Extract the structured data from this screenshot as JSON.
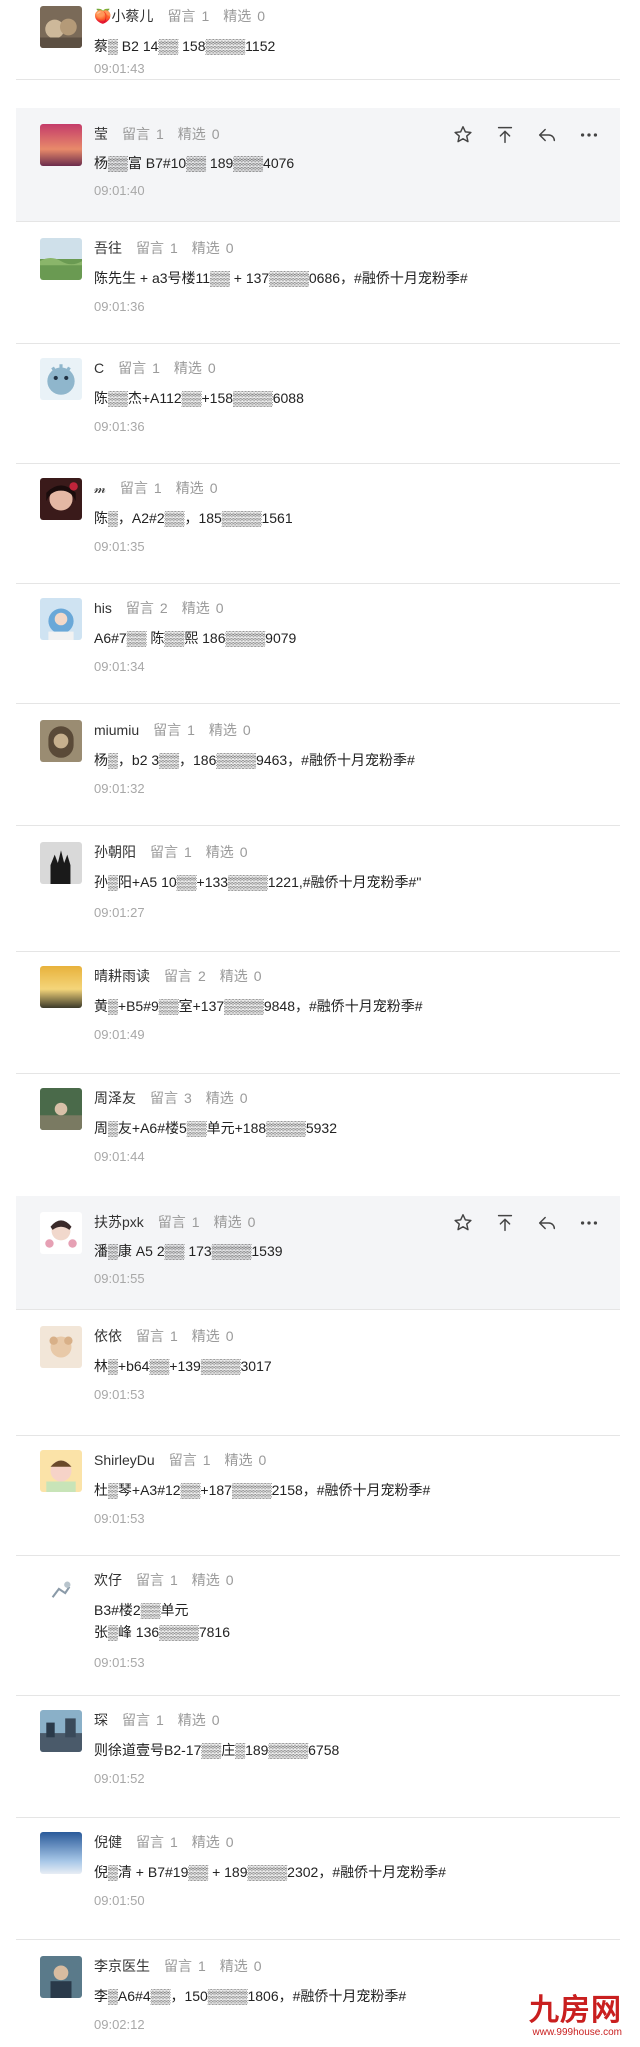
{
  "labels": {
    "comment": "留言",
    "featured": "精选"
  },
  "comments": [
    {
      "nickname": "小蔡儿",
      "prefix_icon": "peach-emoji",
      "comments": "1",
      "featured": "0",
      "lines": [
        "蔡▒   B2 14▒▒    158▒▒▒▒1152"
      ],
      "time": "09:01:43"
    },
    {
      "nickname": "莹",
      "comments": "1",
      "featured": "0",
      "lines": [
        "杨▒▒富 B7#10▒▒ 189▒▒▒4076"
      ],
      "time": "09:01:40",
      "highlighted": true
    },
    {
      "nickname": "吾往",
      "comments": "1",
      "featured": "0",
      "lines": [
        "陈先生 + a3号楼11▒▒ + 137▒▒▒▒0686，#融侨十月宠粉季#"
      ],
      "time": "09:01:36"
    },
    {
      "nickname": "C",
      "comments": "1",
      "featured": "0",
      "lines": [
        "陈▒▒杰+A112▒▒+158▒▒▒▒6088"
      ],
      "time": "09:01:36"
    },
    {
      "nickname": "𝓂",
      "comments": "1",
      "featured": "0",
      "lines": [
        "陈▒，A2#2▒▒，185▒▒▒▒1561"
      ],
      "time": "09:01:35"
    },
    {
      "nickname": "his",
      "comments": "2",
      "featured": "0",
      "lines": [
        "A6#7▒▒   陈▒▒熙 186▒▒▒▒9079"
      ],
      "time": "09:01:34"
    },
    {
      "nickname": "miumiu",
      "comments": "1",
      "featured": "0",
      "lines": [
        "杨▒，b2 3▒▒，186▒▒▒▒9463，#融侨十月宠粉季#"
      ],
      "time": "09:01:32"
    },
    {
      "nickname": "孙朝阳",
      "comments": "1",
      "featured": "0",
      "lines": [
        "孙▒阳+A5 10▒▒+133▒▒▒▒1221,#融侨十月宠粉季#\""
      ],
      "time": "09:01:27"
    },
    {
      "nickname": "晴耕雨读",
      "comments": "2",
      "featured": "0",
      "lines": [
        "黄▒+B5#9▒▒室+137▒▒▒▒9848，#融侨十月宠粉季#"
      ],
      "time": "09:01:49"
    },
    {
      "nickname": "周泽友",
      "comments": "3",
      "featured": "0",
      "lines": [
        "周▒友+A6#楼5▒▒单元+188▒▒▒▒5932"
      ],
      "time": "09:01:44"
    },
    {
      "nickname": "扶苏pxk",
      "comments": "1",
      "featured": "0",
      "lines": [
        "潘▒康 A5 2▒▒ 173▒▒▒▒1539"
      ],
      "time": "09:01:55",
      "highlighted": true
    },
    {
      "nickname": "依依",
      "comments": "1",
      "featured": "0",
      "lines": [
        "林▒+b64▒▒+139▒▒▒▒3017"
      ],
      "time": "09:01:53"
    },
    {
      "nickname": "ShirleyDu",
      "comments": "1",
      "featured": "0",
      "lines": [
        "杜▒琴+A3#12▒▒+187▒▒▒▒2158，#融侨十月宠粉季#"
      ],
      "time": "09:01:53"
    },
    {
      "nickname": "欢仔",
      "comments": "1",
      "featured": "0",
      "lines": [
        "B3#楼2▒▒单元",
        "张▒峰 136▒▒▒▒7816"
      ],
      "time": "09:01:53"
    },
    {
      "nickname": "琛",
      "comments": "1",
      "featured": "0",
      "lines": [
        "则徐道壹号B2-17▒▒庄▒189▒▒▒▒6758"
      ],
      "time": "09:01:52"
    },
    {
      "nickname": "倪健",
      "comments": "1",
      "featured": "0",
      "lines": [
        "倪▒清 + B7#19▒▒ + 189▒▒▒▒2302，#融侨十月宠粉季#"
      ],
      "time": "09:01:50"
    },
    {
      "nickname": "李京医生",
      "comments": "1",
      "featured": "0",
      "lines": [
        "李▒A6#4▒▒，150▒▒▒▒1806，#融侨十月宠粉季#"
      ],
      "time": "09:02:12"
    }
  ],
  "watermark": {
    "logo": "九房网",
    "url": "www.999house.com"
  },
  "colors": {
    "highlight_bg": "#f4f5f7",
    "muted": "#9a9a9a",
    "watermark": "#c91f1f"
  }
}
